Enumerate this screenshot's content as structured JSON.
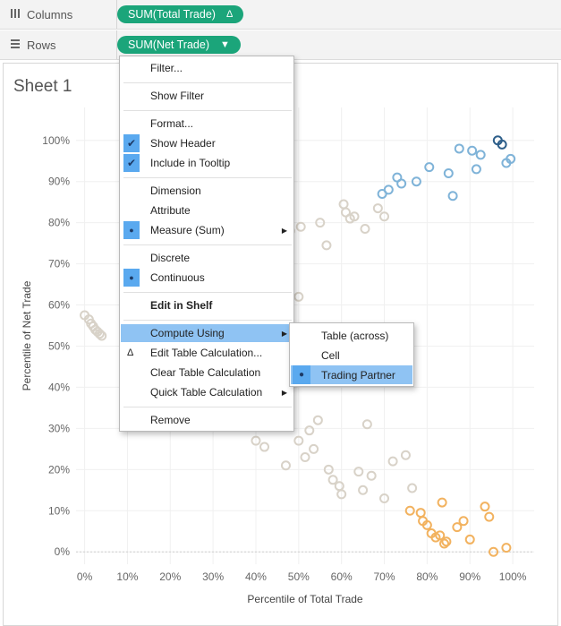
{
  "shelves": {
    "columns": {
      "label": "Columns",
      "icon": "columns-icon",
      "pill": "SUM(Total Trade)",
      "pill_suffix": "Δ"
    },
    "rows": {
      "label": "Rows",
      "icon": "rows-icon",
      "pill": "SUM(Net Trade)",
      "pill_suffix": "▼"
    }
  },
  "sheet_title": "Sheet 1",
  "context_menu": {
    "items": [
      {
        "label": "Filter..."
      },
      {
        "label": "Show Filter"
      },
      {
        "label": "Format..."
      },
      {
        "label": "Show Header",
        "checked": true
      },
      {
        "label": "Include in Tooltip",
        "checked": true
      },
      {
        "label": "Dimension"
      },
      {
        "label": "Attribute"
      },
      {
        "label": "Measure (Sum)",
        "radio": true,
        "submenu": true
      },
      {
        "label": "Discrete"
      },
      {
        "label": "Continuous",
        "radio": true
      },
      {
        "label": "Edit in Shelf",
        "bold": true
      },
      {
        "label": "Compute Using",
        "submenu": true,
        "highlighted": true
      },
      {
        "label": "Edit Table Calculation...",
        "icon": "delta-icon",
        "icon_glyph": "Δ"
      },
      {
        "label": "Clear Table Calculation"
      },
      {
        "label": "Quick Table Calculation",
        "submenu": true
      },
      {
        "label": "Remove"
      }
    ],
    "checkmark_glyph": "✔",
    "radio_glyph": "●",
    "arrow_glyph": "▶"
  },
  "compute_using_submenu": {
    "items": [
      {
        "label": "Table (across)"
      },
      {
        "label": "Cell"
      },
      {
        "label": "Trading Partner",
        "selected": true,
        "highlighted": true
      }
    ]
  },
  "chart_data": {
    "type": "scatter",
    "xlabel": "Percentile of Total Trade",
    "ylabel": "Percentile of Net Trade",
    "xlim": [
      -0.02,
      1.05
    ],
    "ylim": [
      -0.03,
      1.08
    ],
    "x_ticks": [
      "0%",
      "10%",
      "20%",
      "30%",
      "40%",
      "50%",
      "60%",
      "70%",
      "80%",
      "90%",
      "100%"
    ],
    "y_ticks": [
      "0%",
      "10%",
      "20%",
      "30%",
      "40%",
      "50%",
      "60%",
      "70%",
      "80%",
      "90%",
      "100%"
    ],
    "grid": true,
    "marker": "open-circle",
    "colors": {
      "blue": "#7fb3d8",
      "darkblue": "#2e5f8a",
      "gray": "#d8d2c8",
      "orange": "#f2b25f"
    },
    "series": [
      {
        "color": "gray",
        "points": [
          [
            0.0,
            0.575
          ],
          [
            0.01,
            0.565
          ],
          [
            0.015,
            0.555
          ],
          [
            0.02,
            0.548
          ],
          [
            0.025,
            0.54
          ],
          [
            0.03,
            0.535
          ],
          [
            0.035,
            0.53
          ],
          [
            0.04,
            0.525
          ],
          [
            0.48,
            0.78
          ],
          [
            0.505,
            0.79
          ],
          [
            0.55,
            0.8
          ],
          [
            0.565,
            0.745
          ],
          [
            0.5,
            0.62
          ],
          [
            0.605,
            0.845
          ],
          [
            0.61,
            0.825
          ],
          [
            0.62,
            0.81
          ],
          [
            0.63,
            0.815
          ],
          [
            0.655,
            0.785
          ],
          [
            0.685,
            0.835
          ],
          [
            0.7,
            0.815
          ],
          [
            0.4,
            0.27
          ],
          [
            0.42,
            0.255
          ],
          [
            0.47,
            0.21
          ],
          [
            0.5,
            0.27
          ],
          [
            0.515,
            0.23
          ],
          [
            0.525,
            0.295
          ],
          [
            0.535,
            0.25
          ],
          [
            0.545,
            0.32
          ],
          [
            0.57,
            0.2
          ],
          [
            0.58,
            0.175
          ],
          [
            0.595,
            0.16
          ],
          [
            0.6,
            0.14
          ],
          [
            0.64,
            0.195
          ],
          [
            0.65,
            0.15
          ],
          [
            0.67,
            0.185
          ],
          [
            0.66,
            0.31
          ],
          [
            0.7,
            0.13
          ],
          [
            0.72,
            0.22
          ],
          [
            0.75,
            0.235
          ],
          [
            0.765,
            0.155
          ]
        ]
      },
      {
        "color": "blue",
        "points": [
          [
            0.695,
            0.87
          ],
          [
            0.71,
            0.88
          ],
          [
            0.73,
            0.91
          ],
          [
            0.74,
            0.895
          ],
          [
            0.775,
            0.9
          ],
          [
            0.805,
            0.935
          ],
          [
            0.85,
            0.92
          ],
          [
            0.86,
            0.865
          ],
          [
            0.875,
            0.98
          ],
          [
            0.905,
            0.975
          ],
          [
            0.915,
            0.93
          ],
          [
            0.925,
            0.965
          ],
          [
            0.985,
            0.945
          ],
          [
            0.995,
            0.955
          ]
        ]
      },
      {
        "color": "darkblue",
        "points": [
          [
            0.965,
            1.0
          ],
          [
            0.975,
            0.99
          ]
        ]
      },
      {
        "color": "orange",
        "points": [
          [
            0.76,
            0.1
          ],
          [
            0.785,
            0.095
          ],
          [
            0.79,
            0.075
          ],
          [
            0.8,
            0.065
          ],
          [
            0.81,
            0.045
          ],
          [
            0.82,
            0.035
          ],
          [
            0.83,
            0.04
          ],
          [
            0.835,
            0.12
          ],
          [
            0.84,
            0.02
          ],
          [
            0.845,
            0.025
          ],
          [
            0.87,
            0.06
          ],
          [
            0.885,
            0.075
          ],
          [
            0.9,
            0.03
          ],
          [
            0.935,
            0.11
          ],
          [
            0.945,
            0.085
          ],
          [
            0.955,
            0.0
          ],
          [
            0.985,
            0.01
          ]
        ]
      }
    ]
  }
}
